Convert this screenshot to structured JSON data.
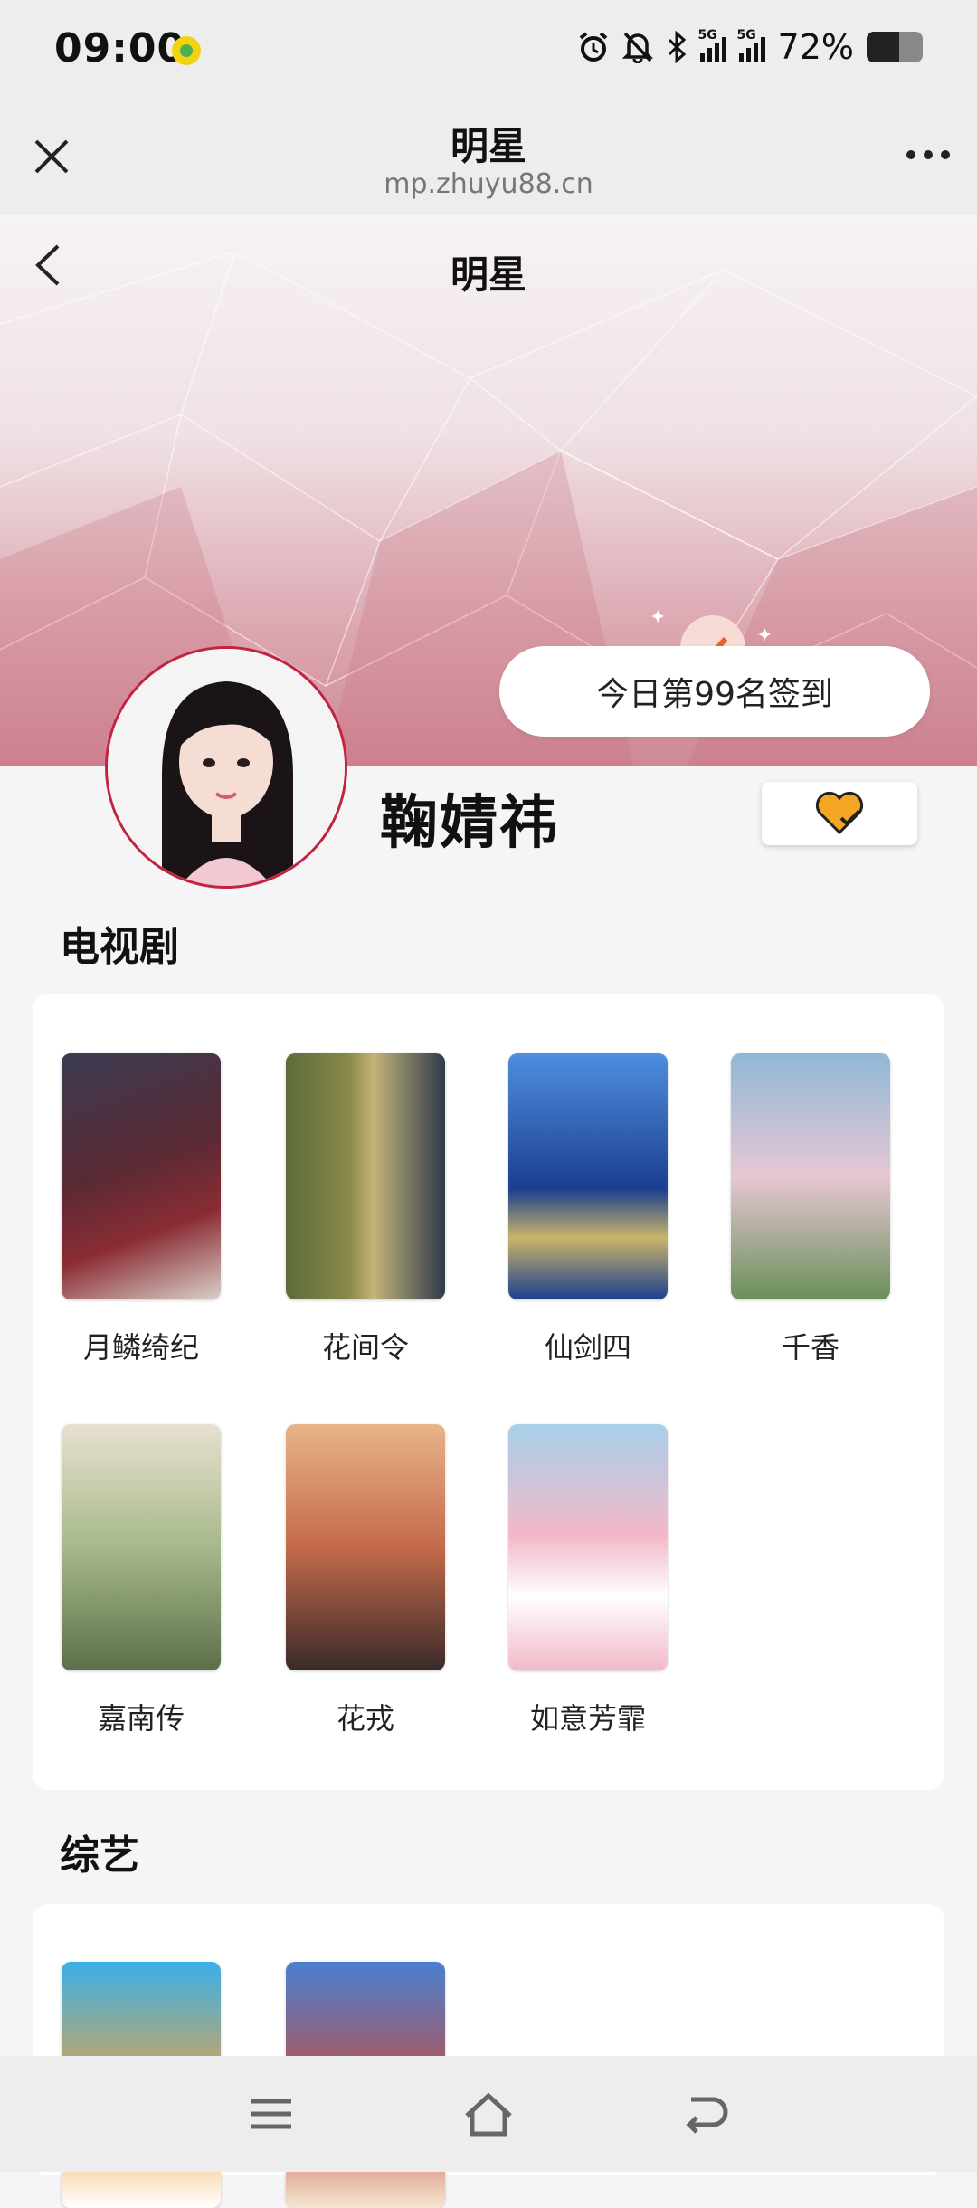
{
  "status_bar": {
    "time": "09:00",
    "battery": "72%",
    "battery_level": 0.72,
    "icons": [
      "alarm-icon",
      "bell-off-icon",
      "bluetooth-icon",
      "signal-5g-icon",
      "signal-5g-icon",
      "battery-icon"
    ],
    "network": "5G"
  },
  "miniprogram": {
    "title": "明星",
    "url": "mp.zhuyu88.cn"
  },
  "page": {
    "title": "明星",
    "checkin_text": "今日第99名签到",
    "star_name": "鞠婧祎"
  },
  "sections": [
    {
      "title": "电视剧",
      "items": [
        {
          "label": "月鳞绮纪",
          "poster_colors": [
            "#3b3b52",
            "#8a2c34",
            "#d9d0c8"
          ]
        },
        {
          "label": "花间令",
          "poster_colors": [
            "#5d6b3a",
            "#c4b47a",
            "#2e3a4a"
          ]
        },
        {
          "label": "仙剑四",
          "poster_colors": [
            "#1c3f8f",
            "#4f8ee0",
            "#c9b46a"
          ]
        },
        {
          "label": "千香",
          "poster_colors": [
            "#8fb8d6",
            "#e6c7d3",
            "#6b8f5a"
          ]
        },
        {
          "label": "嘉南传",
          "poster_colors": [
            "#a7b98a",
            "#e8e0d0",
            "#5b6f4a"
          ]
        },
        {
          "label": "花戎",
          "poster_colors": [
            "#c46a4a",
            "#e8b48a",
            "#3a2a2a"
          ]
        },
        {
          "label": "如意芳霏",
          "poster_colors": [
            "#f3b8c8",
            "#a9d0ea",
            "#ffffff"
          ]
        }
      ]
    },
    {
      "title": "综艺",
      "items": [
        {
          "label": "",
          "poster_colors": [
            "#3ab0e8",
            "#f3a23a",
            "#ffffff"
          ]
        },
        {
          "label": "",
          "poster_colors": [
            "#4a7fd0",
            "#c84a3a",
            "#f3e6d0"
          ]
        }
      ]
    }
  ],
  "colors": {
    "accent": "#f5a623",
    "brand_red": "#c2243f",
    "banner_pink": "#d98f9c"
  }
}
